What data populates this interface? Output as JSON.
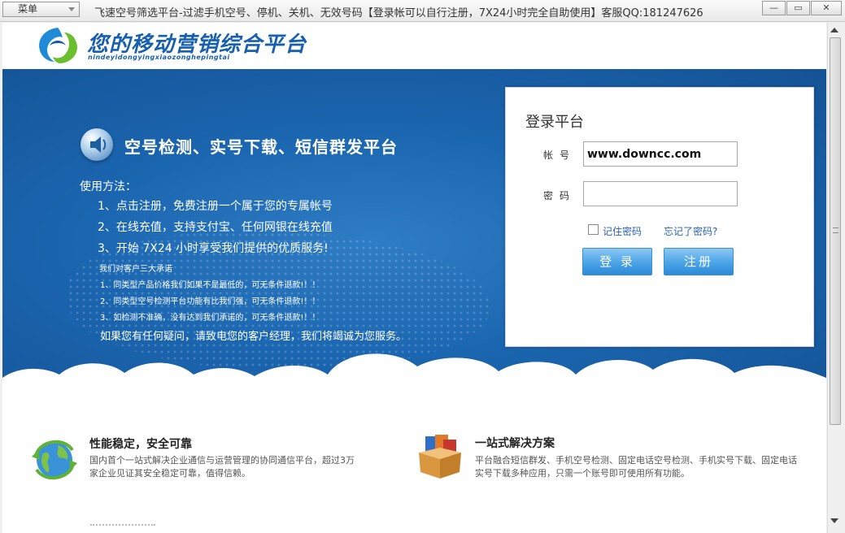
{
  "titlebar": {
    "menu_label": "菜单",
    "title": "飞速空号筛选平台-过滤手机空号、停机、关机、无效号码【登录帐可以自行注册，7X24小时完全自助使用】客服QQ:181247626",
    "minimize": "—",
    "restore": "▭",
    "close": "✕"
  },
  "header": {
    "logo_title": "您的移动营销综合平台",
    "logo_subtitle": "nindeyidongyingxiaozonghepingtai"
  },
  "banner": {
    "slogan": "空号检测、实号下载、短信群发平台",
    "usage_title": "使用方法：",
    "usage_steps": [
      "1、点击注册，免费注册一个属于您的专属帐号",
      "2、在线充值，支持支付宝、任何网银在线充值",
      "3、开始 7X24 小时享受我们提供的优质服务!"
    ],
    "promise_title": "我们对客户三大承诺",
    "promises": [
      "1、同类型产品价格我们如果不是最低的，可无条件退款!！！",
      "2、同类型空号检测平台功能有比我们强，可无条件退款!！！",
      "3、如检测不准确，没有达到我们承诺的，可无条件退款!！！"
    ],
    "contact": "如果您有任何疑问，请致电您的客户经理，我们将竭诚为您服务。",
    "carousel_active_index": 0
  },
  "login": {
    "title": "登录平台",
    "account_label": "帐号",
    "account_value": "www.downcc.com",
    "password_label": "密码",
    "password_value": "",
    "remember_label": "记住密码",
    "remember_checked": false,
    "forgot_label": "忘记了密码?",
    "login_button": "登 录",
    "register_button": "注册"
  },
  "features": [
    {
      "icon": "globe-refresh-icon",
      "title": "性能稳定，安全可靠",
      "desc": "国内首个一站式解决企业通信与运营管理的协同通信平台，超过3万家企业见证其安全稳定可靠，值得信赖。"
    },
    {
      "icon": "office-box-icon",
      "title": "一站式解决方案",
      "desc": "平台融合短信群发、手机空号检测、固定电话空号检测、手机实号下载、固定电话实号下载多种应用，只需一个账号即可使用所有功能。"
    }
  ],
  "colors": {
    "brand_blue": "#1760b0",
    "banner_blue": "#1b66b0",
    "button_blue": "#4aa3e6",
    "link_blue": "#2b62b0"
  }
}
